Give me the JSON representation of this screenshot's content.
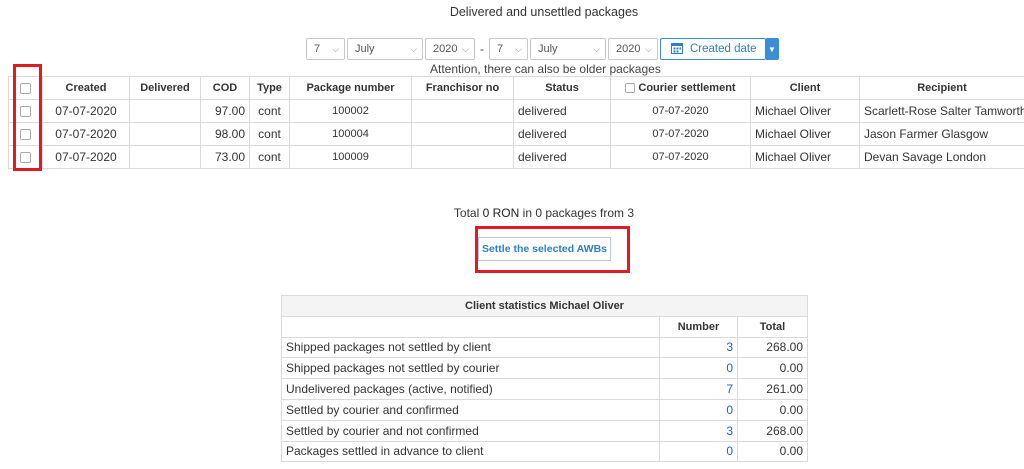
{
  "page": {
    "title": "Delivered and unsettled packages",
    "attention": "Attention, there can also be older packages"
  },
  "filter": {
    "from_day": "7",
    "from_month": "July",
    "from_year": "2020",
    "separator": "-",
    "to_day": "7",
    "to_month": "July",
    "to_year": "2020",
    "date_button_label": "Created date"
  },
  "packages_table": {
    "headers": {
      "created": "Created",
      "delivered": "Delivered",
      "cod": "COD",
      "type": "Type",
      "package_number": "Package number",
      "franchisor_no": "Franchisor no",
      "status": "Status",
      "courier_settlement": "Courier settlement",
      "client": "Client",
      "recipient": "Recipient"
    },
    "rows": [
      {
        "created": "07-07-2020",
        "delivered": "",
        "cod": "97.00",
        "type": "cont",
        "package_number": "100002",
        "franchisor_no": "",
        "status": "delivered",
        "courier_settlement": "07-07-2020",
        "client": "Michael Oliver",
        "recipient": "Scarlett-Rose Salter Tamworth"
      },
      {
        "created": "07-07-2020",
        "delivered": "",
        "cod": "98.00",
        "type": "cont",
        "package_number": "100004",
        "franchisor_no": "",
        "status": "delivered",
        "courier_settlement": "07-07-2020",
        "client": "Michael Oliver",
        "recipient": "Jason Farmer Glasgow"
      },
      {
        "created": "07-07-2020",
        "delivered": "",
        "cod": "73.00",
        "type": "cont",
        "package_number": "100009",
        "franchisor_no": "",
        "status": "delivered",
        "courier_settlement": "07-07-2020",
        "client": "Michael Oliver",
        "recipient": "Devan Savage London"
      }
    ]
  },
  "summary": {
    "total_label": "Total",
    "amount": "0 RON",
    "text_in": "in 0 packages from 3"
  },
  "settle_button": "Settle the selected AWBs",
  "stats": {
    "title": "Client statistics Michael Oliver",
    "col_number": "Number",
    "col_total": "Total",
    "rows": [
      {
        "label": "Shipped packages not settled by client",
        "number": "3",
        "total": "268.00"
      },
      {
        "label": "Shipped packages not settled by courier",
        "number": "0",
        "total": "0.00"
      },
      {
        "label": "Undelivered packages (active, notified)",
        "number": "7",
        "total": "261.00"
      },
      {
        "label": "Settled by courier and confirmed",
        "number": "0",
        "total": "0.00"
      },
      {
        "label": "Settled by courier and not confirmed",
        "number": "3",
        "total": "268.00"
      },
      {
        "label": "Packages settled in advance to client",
        "number": "0",
        "total": "0.00"
      }
    ]
  },
  "colors": {
    "link": "#2166b0",
    "accent": "#3a8fd4",
    "highlight": "#e01b24"
  }
}
